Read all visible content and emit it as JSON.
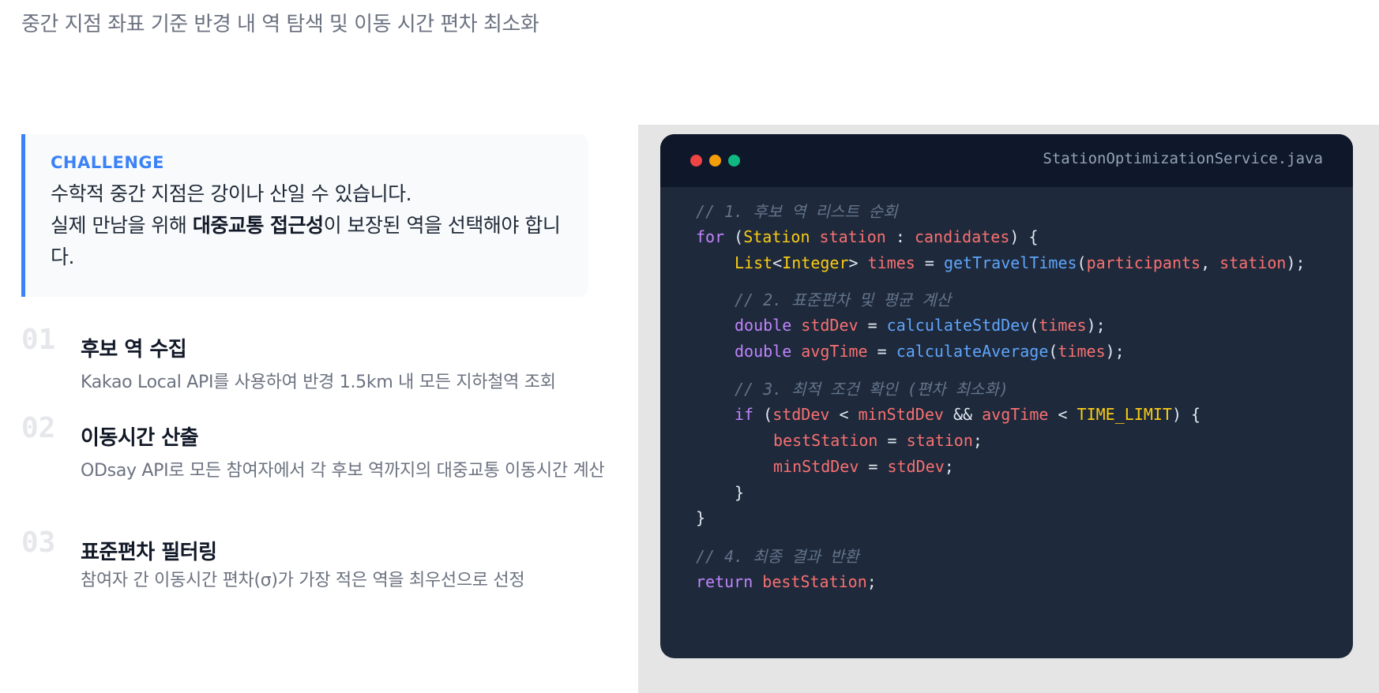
{
  "subtitle": "중간 지점 좌표 기준 반경 내 역 탐색 및 이동 시간 편차 최소화",
  "challenge": {
    "label": "CHALLENGE",
    "line1": "수학적 중간 지점은 강이나 산일 수 있습니다.",
    "line2_pre": "실제 만남을 위해 ",
    "line2_bold": "대중교통 접근성",
    "line2_post": "이 보장된 역을 선택해야 합니다."
  },
  "steps": [
    {
      "num": "01",
      "title": "후보 역 수집",
      "desc": "Kakao Local API를 사용하여 반경 1.5km 내 모든 지하철역 조회"
    },
    {
      "num": "02",
      "title": "이동시간 산출",
      "desc": "ODsay API로 모든 참여자에서 각 후보 역까지의 대중교통 이동시간 계산"
    },
    {
      "num": "03",
      "title": "표준편차 필터링",
      "desc": "참여자 간 이동시간 편차(σ)가 가장 적은 역을 최우선으로 선정"
    }
  ],
  "code_window": {
    "filename": "StationOptimizationService.java",
    "colors": {
      "red": "#ef4444",
      "yellow": "#f59e0b",
      "green": "#10b981"
    }
  },
  "code": {
    "c1": "// 1. 후보 역 리스트 순회",
    "for_kw": "for",
    "for_open": " (",
    "for_type": "Station",
    "for_var": " station",
    "for_colon": " : ",
    "for_cands": "candidates",
    "for_close": ") {",
    "list_type": "List",
    "list_lt": "<",
    "list_int": "Integer",
    "list_gt": "> ",
    "list_times": "times",
    "list_eq": " = ",
    "list_fn": "getTravelTimes",
    "list_open": "(",
    "list_parts": "participants",
    "list_comma": ", ",
    "list_station": "station",
    "list_end": ");",
    "c2": "// 2. 표준편차 및 평균 계산",
    "d1_kw": "double",
    "d1_var": " stdDev",
    "d1_eq": " = ",
    "d1_fn": "calculateStdDev",
    "d1_open": "(",
    "d1_arg": "times",
    "d1_end": ");",
    "d2_kw": "double",
    "d2_var": " avgTime",
    "d2_eq": " = ",
    "d2_fn": "calculateAverage",
    "d2_open": "(",
    "d2_arg": "times",
    "d2_end": ");",
    "c3": "// 3. 최적 조건 확인 (편차 최소화)",
    "if_kw": "if",
    "if_open": " (",
    "if_a": "stdDev",
    "if_lt1": " < ",
    "if_b": "minStdDev",
    "if_and": " && ",
    "if_c": "avgTime",
    "if_lt2": " < ",
    "if_d": "TIME_LIMIT",
    "if_close": ") {",
    "bs_var": "bestStation",
    "bs_eq": " = ",
    "bs_val": "station",
    "bs_end": ";",
    "ms_var": "minStdDev",
    "ms_eq": " = ",
    "ms_val": "stdDev",
    "ms_end": ";",
    "close_inner": "}",
    "close_outer": "}",
    "c4": "// 4. 최종 결과 반환",
    "ret_kw": "return",
    "ret_var": " bestStation",
    "ret_end": ";"
  }
}
